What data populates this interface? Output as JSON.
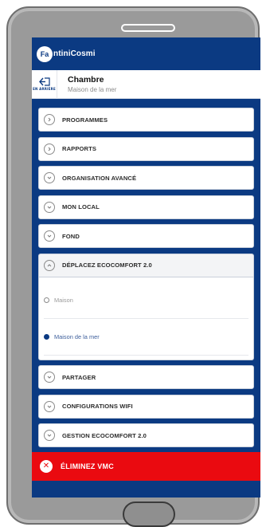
{
  "app": {
    "brand_badge": "Fa",
    "brand_text": "ntiniCosmi"
  },
  "room": {
    "back_label": "EN ARRIÈRE",
    "title": "Chambre",
    "subtitle": "Maison de la mer"
  },
  "menu": {
    "items": [
      {
        "label": "PROGRAMMES",
        "icon": "chevron-right-icon"
      },
      {
        "label": "RAPPORTS",
        "icon": "chevron-right-icon"
      },
      {
        "label": "ORGANISATION AVANCÉ",
        "icon": "chevron-down-icon"
      },
      {
        "label": "MON LOCAL",
        "icon": "chevron-down-icon"
      },
      {
        "label": "FOND",
        "icon": "chevron-down-icon"
      },
      {
        "label": "DÉPLACEZ ECOCOMFORT 2.0",
        "icon": "chevron-up-icon"
      },
      {
        "label": "PARTAGER",
        "icon": "chevron-down-icon"
      },
      {
        "label": "CONFIGURATIONS WIFI",
        "icon": "chevron-down-icon"
      },
      {
        "label": "GESTION ECOCOMFORT 2.0",
        "icon": "chevron-down-icon"
      }
    ],
    "move_options": [
      {
        "label": "Maison",
        "selected": false
      },
      {
        "label": "Maison de la mer",
        "selected": true
      }
    ],
    "delete_label": "ÉLIMINEZ VMC",
    "delete_icon": "close-icon"
  },
  "colors": {
    "brand_blue": "#0b3a82",
    "danger_red": "#ea0a10",
    "phone_body": "#9a9a9a"
  }
}
